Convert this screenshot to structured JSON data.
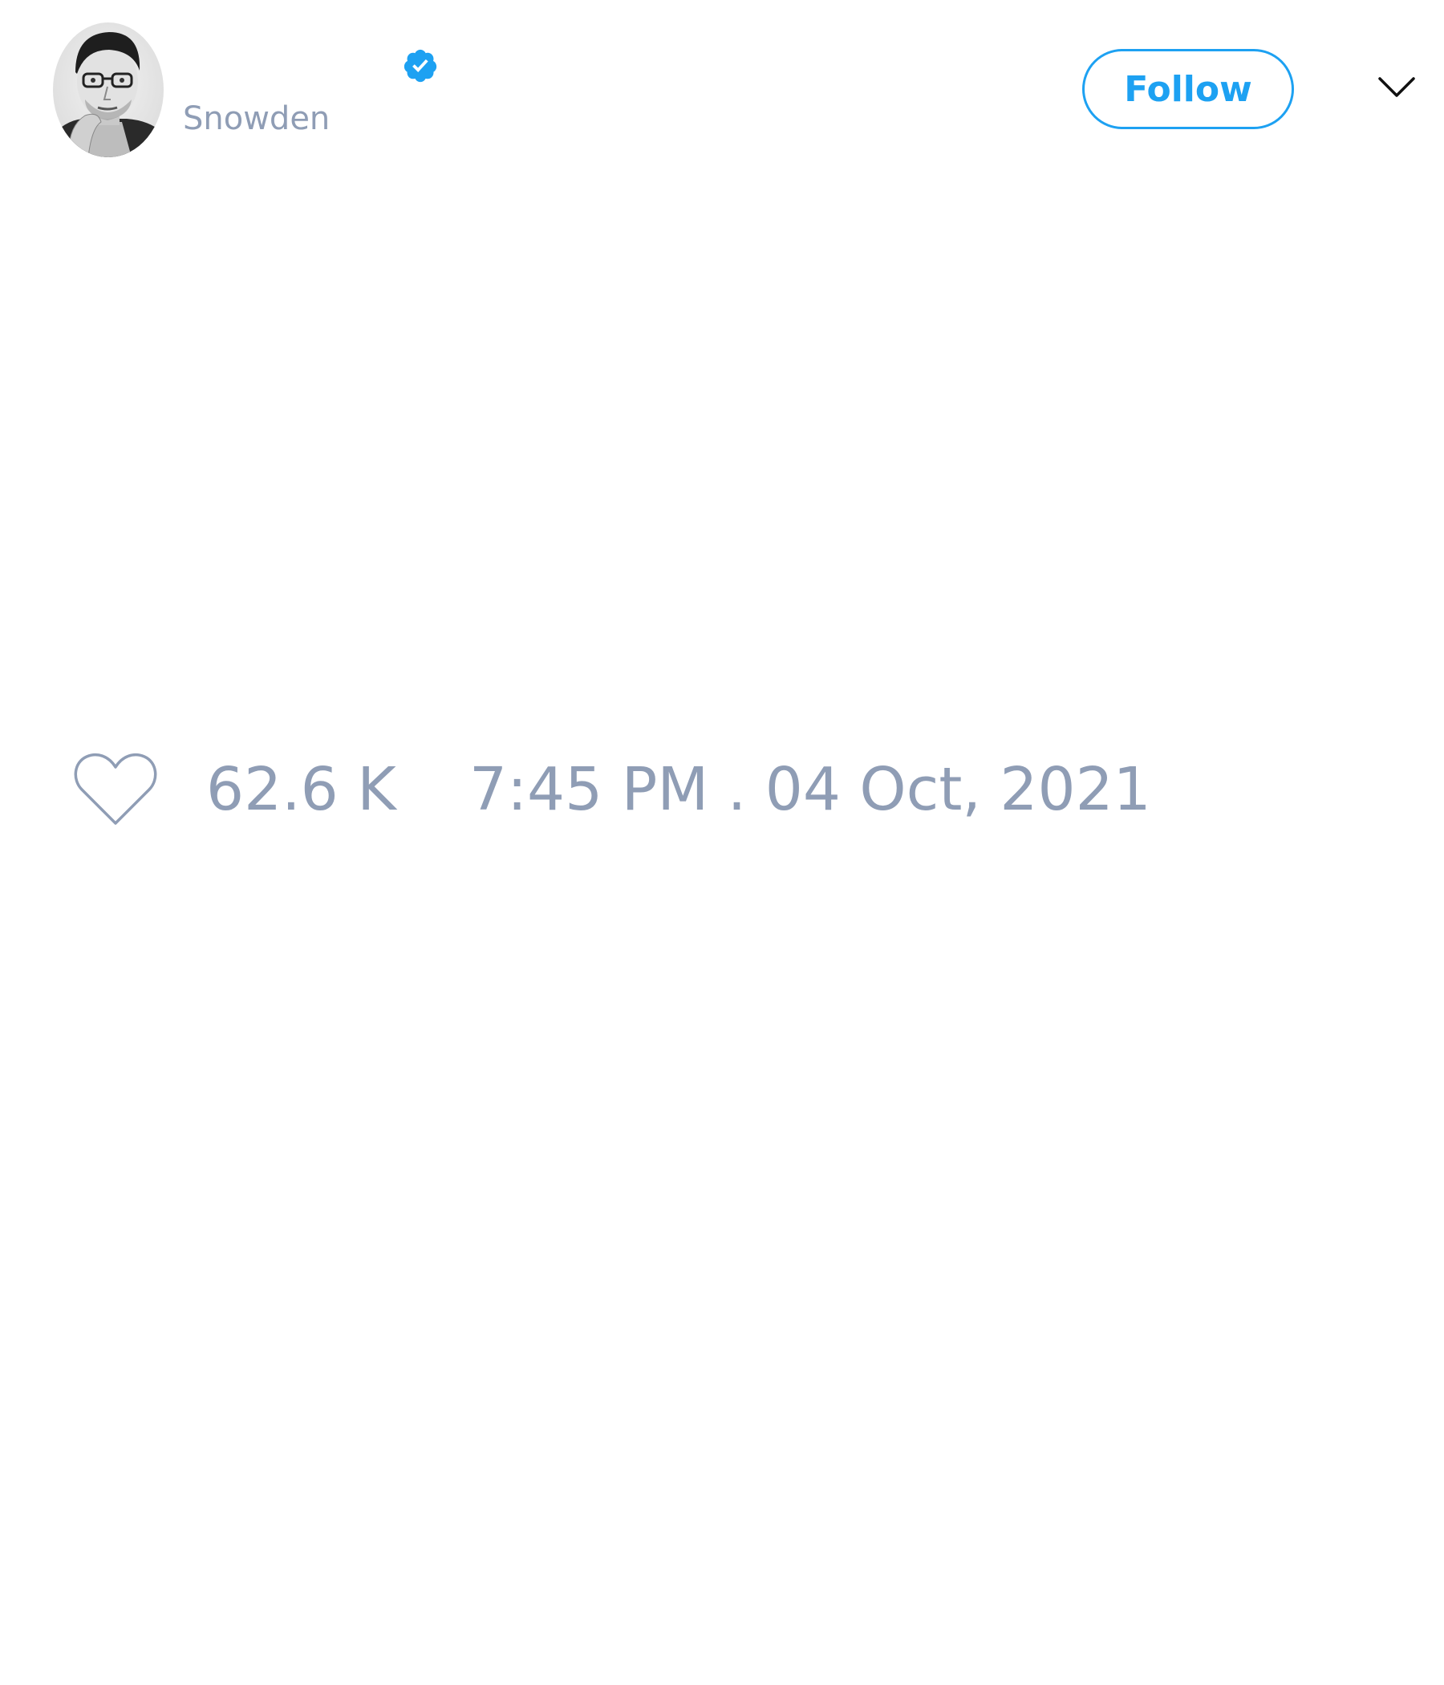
{
  "tweet": {
    "author": {
      "handle": "Snowden",
      "verified": true,
      "avatar_icon": "person-photo-grayscale"
    },
    "follow_label": "Follow",
    "menu_icon": "chevron-down-icon",
    "likes": {
      "icon": "heart-outline-icon",
      "count": "62.6 K"
    },
    "timestamp": "7:45 PM . 04 Oct, 2021"
  },
  "colors": {
    "accent": "#1da1f2",
    "muted_text": "#8f9db5",
    "background": "#ffffff"
  }
}
